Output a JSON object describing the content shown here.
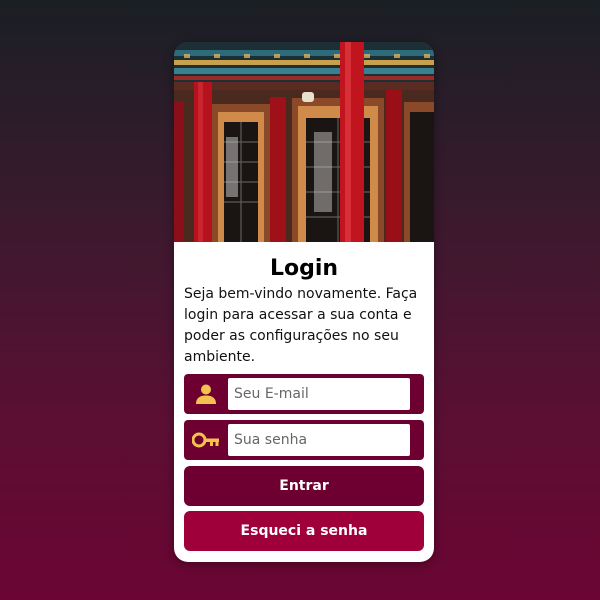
{
  "login": {
    "title": "Login",
    "description": "Seja bem-vindo novamente. Faça login para acessar a sua conta e poder as configurações no seu ambiente.",
    "email": {
      "placeholder": "Seu E-mail",
      "value": ""
    },
    "password": {
      "placeholder": "Sua senha",
      "value": ""
    },
    "submit_label": "Entrar",
    "forgot_label": "Esqueci a senha"
  },
  "icons": {
    "email_field": "user-icon",
    "password_field": "key-icon"
  },
  "colors": {
    "primary": "#6d0030",
    "secondary": "#a0003a",
    "icon": "#f2c14e"
  }
}
